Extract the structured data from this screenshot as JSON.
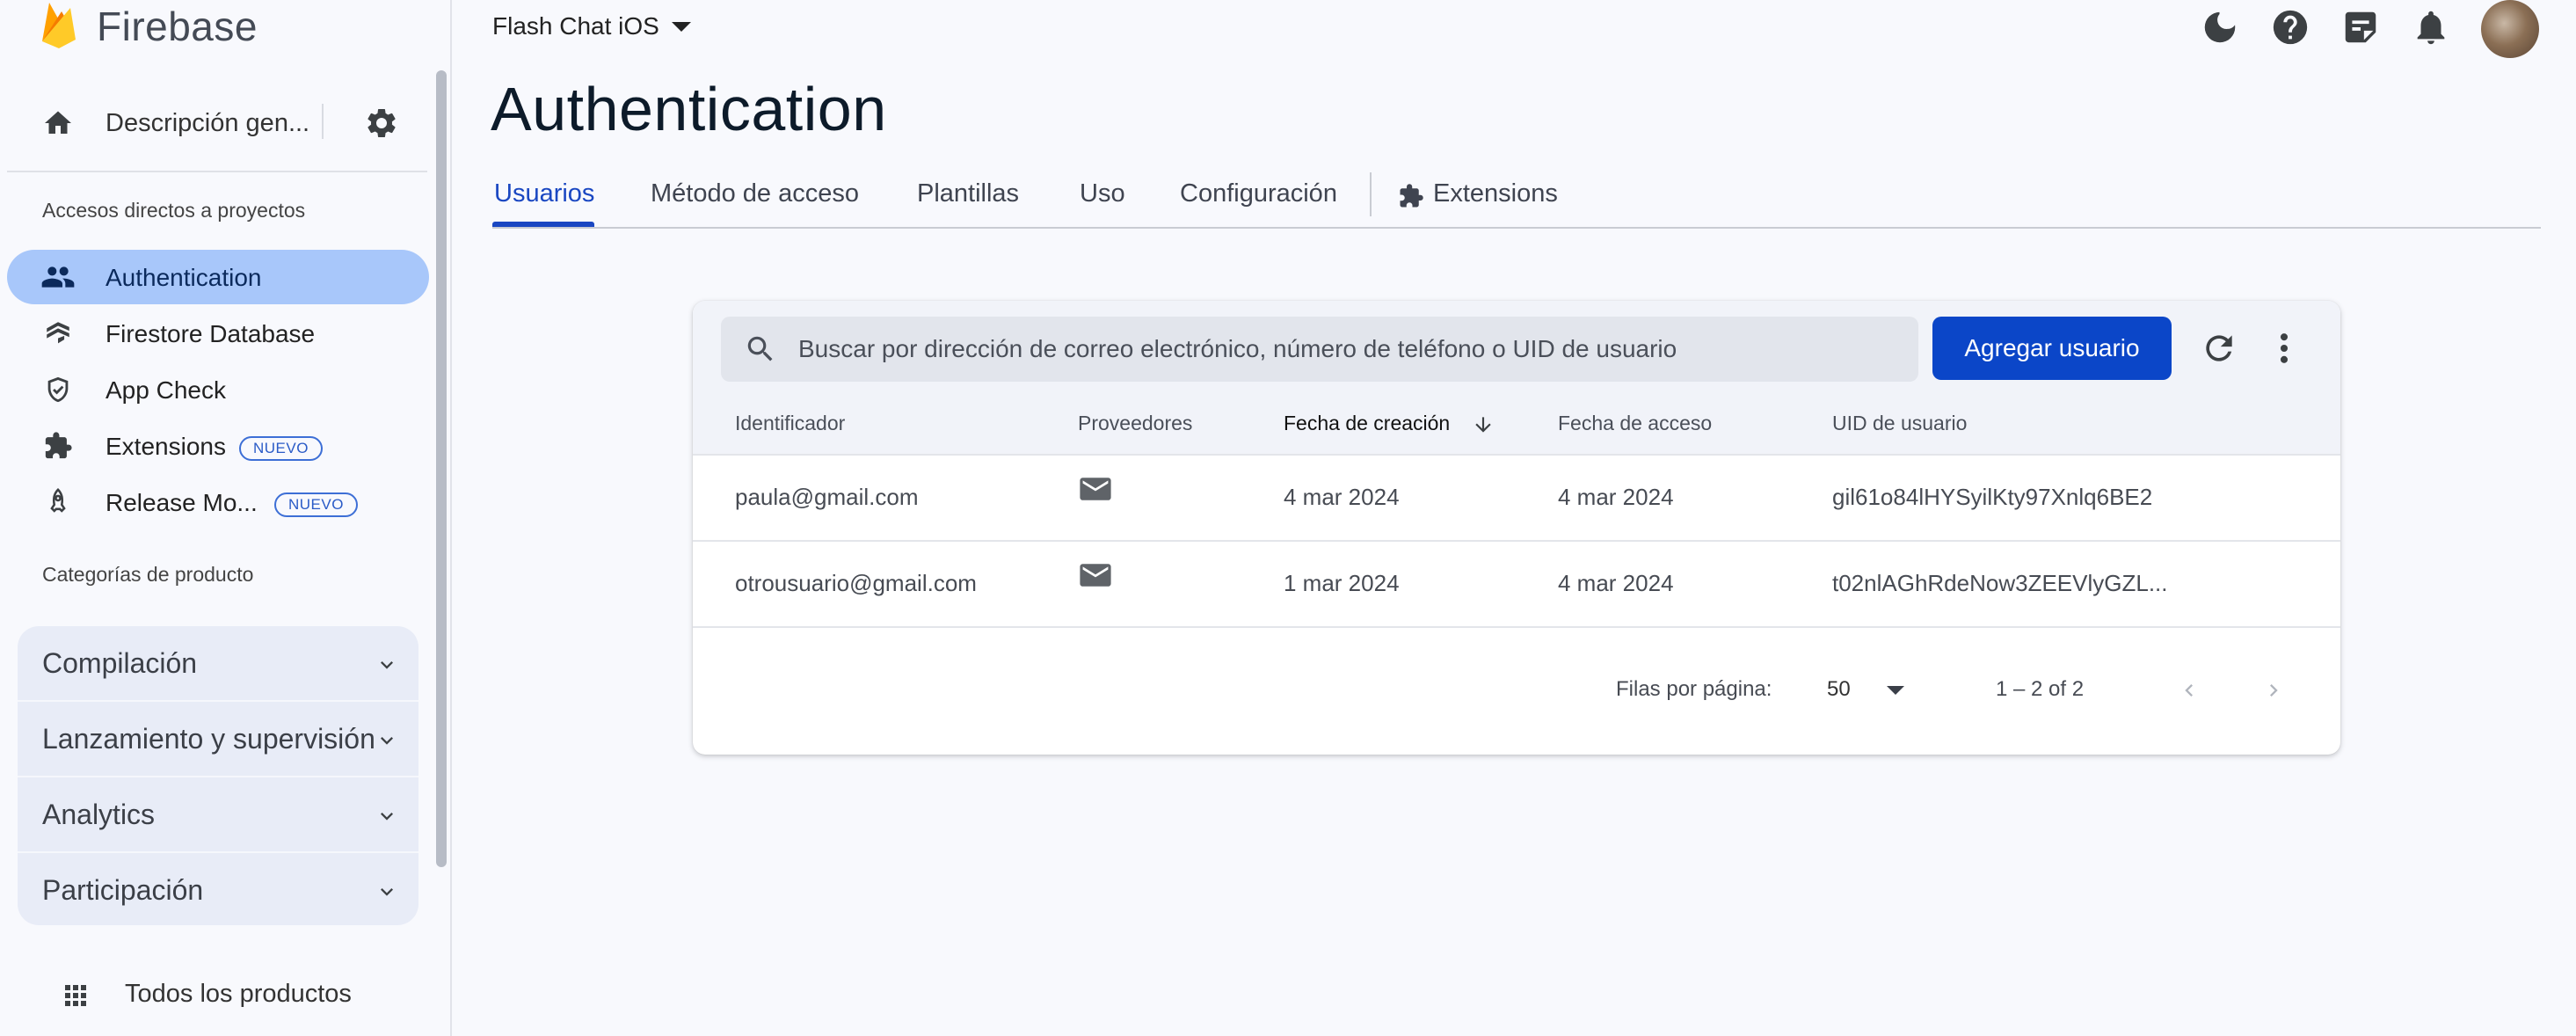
{
  "brand": {
    "name": "Firebase"
  },
  "sidebar": {
    "overview_label": "Descripción gen...",
    "shortcuts_label": "Accesos directos a proyectos",
    "items": [
      {
        "label": "Authentication",
        "icon": "people-icon",
        "active": true
      },
      {
        "label": "Firestore Database",
        "icon": "firestore-icon"
      },
      {
        "label": "App Check",
        "icon": "shield-check-icon"
      },
      {
        "label": "Extensions",
        "icon": "extension-icon",
        "badge": "NUEVO"
      },
      {
        "label": "Release Mo...",
        "icon": "rocket-icon",
        "badge": "NUEVO"
      }
    ],
    "categories_label": "Categorías de producto",
    "categories": [
      {
        "label": "Compilación"
      },
      {
        "label": "Lanzamiento y supervisión"
      },
      {
        "label": "Analytics"
      },
      {
        "label": "Participación"
      }
    ],
    "all_products_label": "Todos los productos"
  },
  "header": {
    "project_name": "Flash Chat iOS",
    "icons": [
      "dark-mode-icon",
      "help-icon",
      "notes-icon",
      "notifications-icon",
      "avatar"
    ]
  },
  "page": {
    "title": "Authentication",
    "tabs": [
      {
        "label": "Usuarios",
        "active": true
      },
      {
        "label": "Método de acceso"
      },
      {
        "label": "Plantillas"
      },
      {
        "label": "Uso"
      },
      {
        "label": "Configuración"
      },
      {
        "label": "Extensions"
      }
    ]
  },
  "users_table": {
    "search_placeholder": "Buscar por dirección de correo electrónico, número de teléfono o UID de usuario",
    "add_button_label": "Agregar usuario",
    "columns": [
      "Identificador",
      "Proveedores",
      "Fecha de creación",
      "Fecha de acceso",
      "UID de usuario"
    ],
    "sorted_column": "Fecha de creación",
    "rows": [
      {
        "identifier": "paula@gmail.com",
        "provider": "email-icon",
        "created": "4 mar 2024",
        "signed_in": "4 mar 2024",
        "uid": "gil61o84lHYSyilKty97Xnlq6BE2"
      },
      {
        "identifier": "otrousuario@gmail.com",
        "provider": "email-icon",
        "created": "1 mar 2024",
        "signed_in": "4 mar 2024",
        "uid": "t02nlAGhRdeNow3ZEEVlyGZL..."
      }
    ],
    "rows_per_page_label": "Filas por página:",
    "rows_per_page": "50",
    "range_label": "1 – 2 of 2"
  },
  "colors": {
    "accent": "#0b46c8",
    "active_nav": "#a8c7fa",
    "badge": "#3d6fd6"
  }
}
